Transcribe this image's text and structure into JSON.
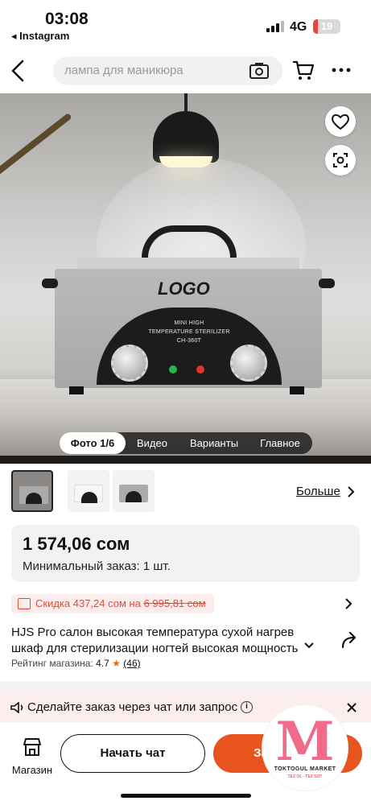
{
  "status_bar": {
    "time": "03:08",
    "back_app": "◂ Instagram",
    "network": "4G",
    "battery": "19",
    "battery_level": 0.19
  },
  "header": {
    "search_placeholder": "лампа для маникюра",
    "icons": [
      "back-arrow-icon",
      "camera-search-icon",
      "cart-icon",
      "more-dots-icon"
    ]
  },
  "gallery": {
    "image_text": {
      "logo": "LOGO",
      "panel_line1": "MINI HIGH",
      "panel_line2": "TEMPERATURE STERILIZER",
      "panel_model": "CH-360T"
    },
    "tabs": [
      {
        "label": "Фото 1/6",
        "active": true
      },
      {
        "label": "Видео",
        "active": false
      },
      {
        "label": "Варианты",
        "active": false
      },
      {
        "label": "Главное",
        "active": false
      }
    ],
    "icons": [
      "heart-icon",
      "image-scan-icon"
    ]
  },
  "thumbnails": {
    "count": 3,
    "selected_index": 0,
    "more_label": "Больше"
  },
  "price": {
    "value": "1 574,06 сом",
    "min_order": "Минимальный заказ: 1 шт."
  },
  "discount": {
    "prefix": "Скидка 437,24 сом на ",
    "strike": "6 995,81 сом",
    "color": "#e64a2e"
  },
  "product": {
    "title_line1": "HJS Pro салон высокая температура сухой нагрев",
    "title_line2": "шкаф для стерилизации ногтей высокая мощность",
    "rating_label": "Рейтинг магазина: ",
    "rating_value": "4.7",
    "rating_count": "(46)"
  },
  "chat_banner": {
    "text": "Сделайте заказ через чат или запрос",
    "background": "#fdeeee"
  },
  "bottom_bar": {
    "shop_label": "Магазин",
    "chat_button": "Начать чат",
    "order_button": "Заказать",
    "accent": "#e8541e"
  },
  "watermark": {
    "letter": "M",
    "line1": "TOKTOGUL MARKET",
    "line2": "TEZ OL - TEZ SOT"
  }
}
